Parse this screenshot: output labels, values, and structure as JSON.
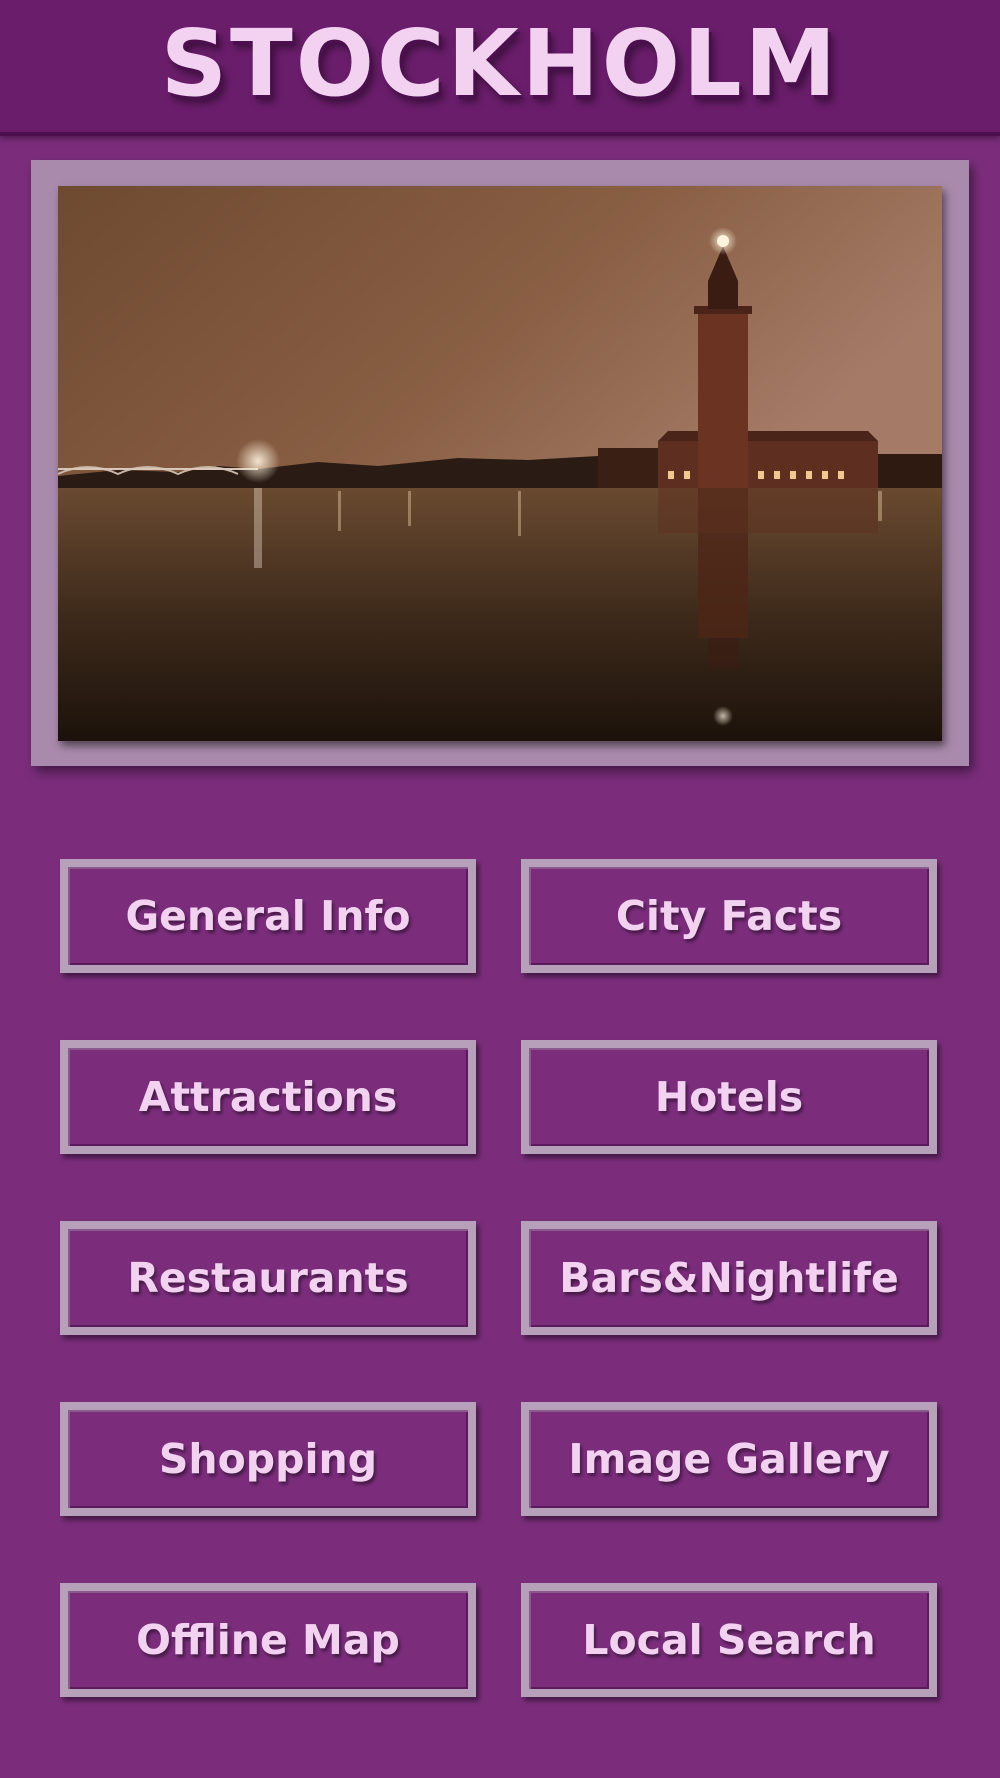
{
  "header": {
    "title": "STOCKHOLM"
  },
  "hero_image": {
    "subject": "Stockholm City Hall at night reflected on water"
  },
  "menu": {
    "general_info": "General Info",
    "city_facts": "City Facts",
    "attractions": "Attractions",
    "hotels": "Hotels",
    "restaurants": "Restaurants",
    "bars_nightlife": "Bars&Nightlife",
    "shopping": "Shopping",
    "image_gallery": "Image Gallery",
    "offline_map": "Offline Map",
    "local_search": "Local Search"
  },
  "colors": {
    "background": "#7b2d7c",
    "header": "#6a1d6b",
    "text": "#f2d2f0",
    "frame": "#a98aac"
  }
}
